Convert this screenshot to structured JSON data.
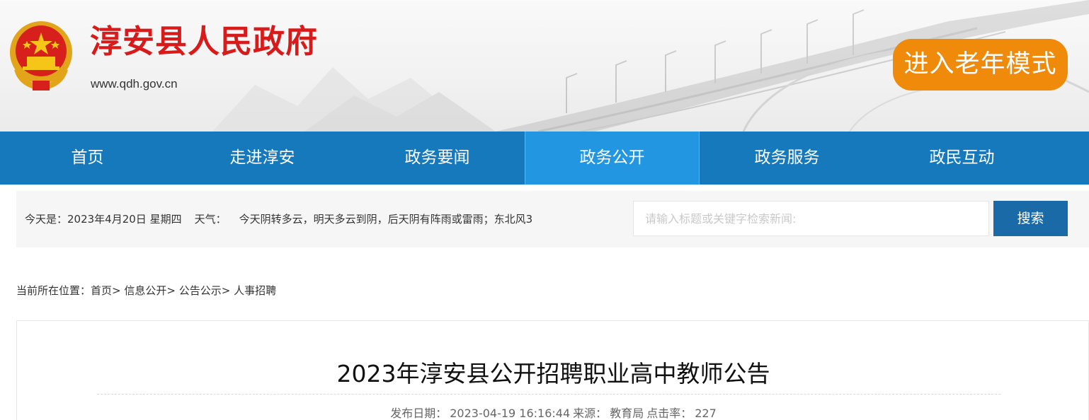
{
  "header": {
    "site_title": "淳安县人民政府",
    "site_url": "www.qdh.gov.cn",
    "elder_mode_label": "进入老年模式",
    "title_color": "#d71a1a",
    "elder_button_color": "#ef8a0b"
  },
  "nav": {
    "items": [
      {
        "label": "首页"
      },
      {
        "label": "走进淳安"
      },
      {
        "label": "政务要闻"
      },
      {
        "label": "政务公开"
      },
      {
        "label": "政务服务"
      },
      {
        "label": "政民互动"
      }
    ],
    "active_index": 3,
    "bg_color": "#1579bb",
    "active_color": "#2296e0"
  },
  "infobar": {
    "date_text": "今天是：2023年4月20日 星期四",
    "weather_label": "天气：",
    "weather_text": "今天阴转多云，明天多云到阴，后天阴有阵雨或雷雨；东北风3",
    "search_placeholder": "请输入标题或关键字检索新闻:",
    "search_button": "搜索"
  },
  "breadcrumb": {
    "prefix": "当前所在位置：",
    "items": [
      "首页",
      "信息公开",
      "公告公示",
      "人事招聘"
    ],
    "separator": "> "
  },
  "article": {
    "title": "2023年淳安县公开招聘职业高中教师公告",
    "publish_label": "发布日期：",
    "publish_date": "2023-04-19 16:16:44",
    "source_label": "来源：",
    "source": "教育局",
    "clicks_label": "点击率：",
    "clicks": "227"
  }
}
